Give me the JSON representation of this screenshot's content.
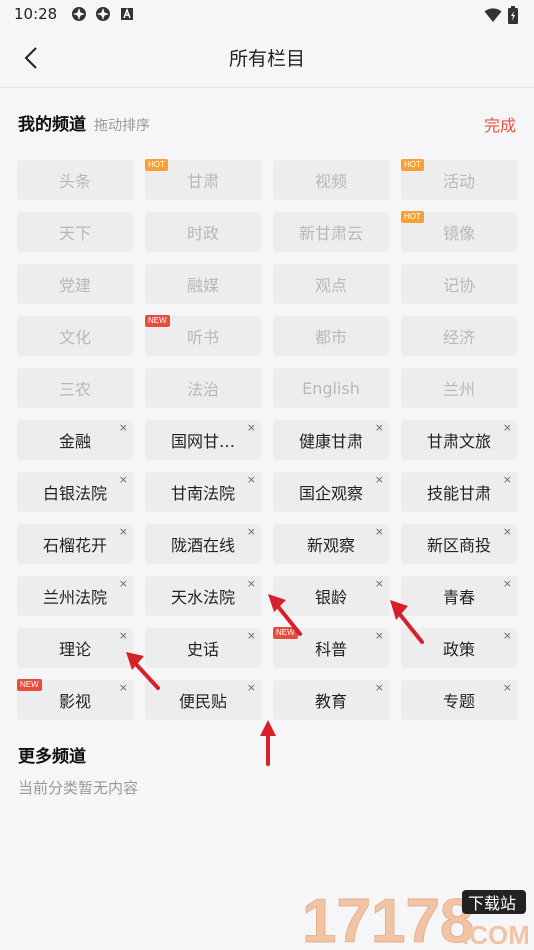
{
  "status": {
    "time": "10:28"
  },
  "nav": {
    "title": "所有栏目"
  },
  "my_channels": {
    "title": "我的频道",
    "hint": "拖动排序",
    "done": "完成"
  },
  "channels": [
    {
      "label": "头条",
      "fixed": true
    },
    {
      "label": "甘肃",
      "fixed": true,
      "badge": "HOT"
    },
    {
      "label": "视频",
      "fixed": true
    },
    {
      "label": "活动",
      "fixed": true,
      "badge": "HOT"
    },
    {
      "label": "天下",
      "fixed": true
    },
    {
      "label": "时政",
      "fixed": true
    },
    {
      "label": "新甘肃云",
      "fixed": true
    },
    {
      "label": "镜像",
      "fixed": true,
      "badge": "HOT"
    },
    {
      "label": "党建",
      "fixed": true
    },
    {
      "label": "融媒",
      "fixed": true
    },
    {
      "label": "观点",
      "fixed": true
    },
    {
      "label": "记协",
      "fixed": true
    },
    {
      "label": "文化",
      "fixed": true
    },
    {
      "label": "听书",
      "fixed": true,
      "badge": "NEW"
    },
    {
      "label": "都市",
      "fixed": true
    },
    {
      "label": "经济",
      "fixed": true
    },
    {
      "label": "三农",
      "fixed": true
    },
    {
      "label": "法治",
      "fixed": true
    },
    {
      "label": "English",
      "fixed": true
    },
    {
      "label": "兰州",
      "fixed": true
    },
    {
      "label": "金融",
      "fixed": false
    },
    {
      "label": "国网甘…",
      "fixed": false
    },
    {
      "label": "健康甘肃",
      "fixed": false
    },
    {
      "label": "甘肃文旅",
      "fixed": false
    },
    {
      "label": "白银法院",
      "fixed": false
    },
    {
      "label": "甘南法院",
      "fixed": false
    },
    {
      "label": "国企观察",
      "fixed": false
    },
    {
      "label": "技能甘肃",
      "fixed": false
    },
    {
      "label": "石榴花开",
      "fixed": false
    },
    {
      "label": "陇酒在线",
      "fixed": false
    },
    {
      "label": "新观察",
      "fixed": false
    },
    {
      "label": "新区商投",
      "fixed": false
    },
    {
      "label": "兰州法院",
      "fixed": false
    },
    {
      "label": "天水法院",
      "fixed": false
    },
    {
      "label": "银龄",
      "fixed": false
    },
    {
      "label": "青春",
      "fixed": false
    },
    {
      "label": "理论",
      "fixed": false
    },
    {
      "label": "史话",
      "fixed": false
    },
    {
      "label": "科普",
      "fixed": false,
      "badge": "NEW"
    },
    {
      "label": "政策",
      "fixed": false
    },
    {
      "label": "影视",
      "fixed": false,
      "badge": "NEW"
    },
    {
      "label": "便民贴",
      "fixed": false
    },
    {
      "label": "教育",
      "fixed": false
    },
    {
      "label": "专题",
      "fixed": false
    }
  ],
  "remove_glyph": "×",
  "more_channels": {
    "title": "更多频道",
    "empty": "当前分类暂无内容"
  },
  "watermark": {
    "text_primary": "17178",
    "text_badge": "下载站",
    "text_domain": ".COM"
  },
  "colors": {
    "accent": "#e8543a",
    "hot": "#f5a030",
    "new": "#e84c3d",
    "arrow": "#d8202a"
  }
}
